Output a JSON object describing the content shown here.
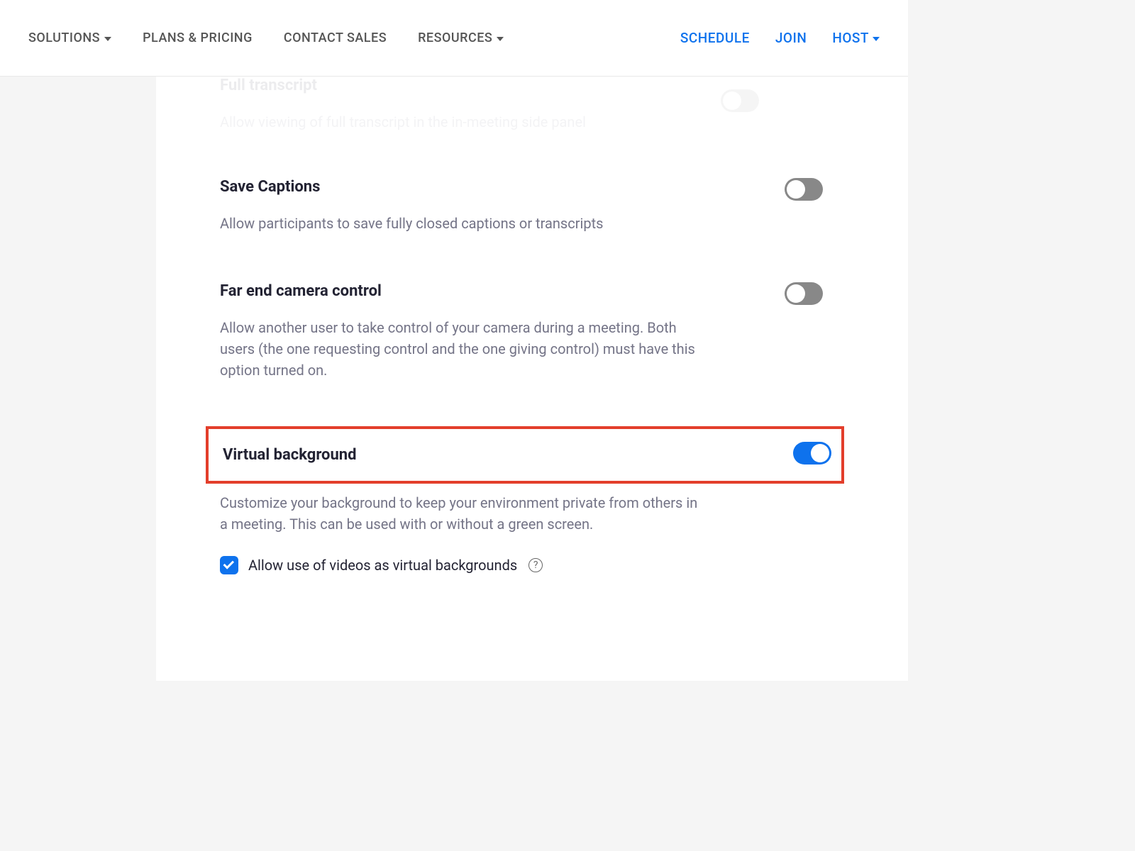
{
  "nav": {
    "left": [
      {
        "label": "SOLUTIONS",
        "has_caret": true
      },
      {
        "label": "PLANS & PRICING",
        "has_caret": false
      },
      {
        "label": "CONTACT SALES",
        "has_caret": false
      },
      {
        "label": "RESOURCES",
        "has_caret": true
      }
    ],
    "right": [
      {
        "label": "SCHEDULE",
        "has_caret": false
      },
      {
        "label": "JOIN",
        "has_caret": false
      },
      {
        "label": "HOST",
        "has_caret": true
      }
    ]
  },
  "faded": {
    "title": "Full transcript",
    "desc": "Allow viewing of full transcript in the in-meeting side panel"
  },
  "settings": {
    "save_captions": {
      "title": "Save Captions",
      "desc": "Allow participants to save fully closed captions or transcripts",
      "enabled": false
    },
    "far_end": {
      "title": "Far end camera control",
      "desc": "Allow another user to take control of your camera during a meeting. Both users (the one requesting control and the one giving control) must have this option turned on.",
      "enabled": false
    },
    "virtual_bg": {
      "title": "Virtual background",
      "desc": "Customize your background to keep your environment private from others in a meeting. This can be used with or without a green screen.",
      "enabled": true,
      "checkbox_label": "Allow use of videos as virtual backgrounds",
      "checkbox_checked": true
    }
  }
}
